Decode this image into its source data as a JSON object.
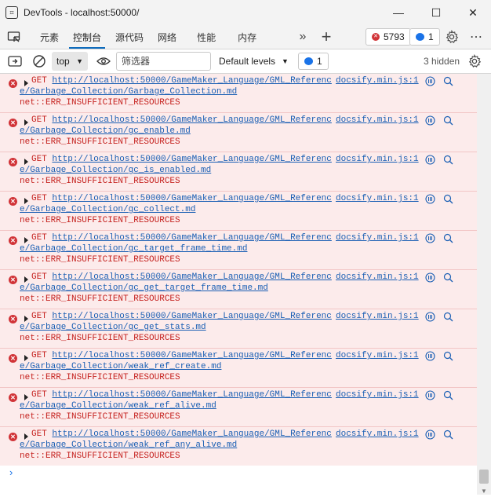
{
  "window": {
    "title": "DevTools - localhost:50000/",
    "app_icon": "devtools-icon",
    "minimize_glyph": "—",
    "maximize_glyph": "☐",
    "close_glyph": "✕"
  },
  "tabs": [
    {
      "label": "元素",
      "active": false
    },
    {
      "label": "控制台",
      "active": true
    },
    {
      "label": "源代码",
      "active": false
    },
    {
      "label": "网络",
      "active": false
    },
    {
      "label": "性能",
      "active": false
    },
    {
      "label": "内存",
      "active": false
    }
  ],
  "tabbar": {
    "more_tabs_glyph": "»",
    "add_tab_glyph": "+",
    "errors_count": "5793",
    "messages_count": "1",
    "more_glyph": "⋯"
  },
  "toolbar": {
    "context": "top",
    "filter_placeholder": "筛选器",
    "levels": "Default levels",
    "issues_count": "1",
    "hidden": "3 hidden"
  },
  "entries": [
    {
      "method": "GET",
      "url_line1": "http://localhost:50000/GameMaker_Language/GML_Referenc",
      "url_line2": "e/Garbage_Collection/Garbage_Collection.md",
      "error": "net::ERR_INSUFFICIENT_RESOURCES",
      "source": "docsify.min.js:1"
    },
    {
      "method": "GET",
      "url_line1": "http://localhost:50000/GameMaker_Language/GML_Referenc",
      "url_line2": "e/Garbage_Collection/gc_enable.md",
      "error": "net::ERR_INSUFFICIENT_RESOURCES",
      "source": "docsify.min.js:1"
    },
    {
      "method": "GET",
      "url_line1": "http://localhost:50000/GameMaker_Language/GML_Referenc",
      "url_line2": "e/Garbage_Collection/gc_is_enabled.md",
      "error": "net::ERR_INSUFFICIENT_RESOURCES",
      "source": "docsify.min.js:1"
    },
    {
      "method": "GET",
      "url_line1": "http://localhost:50000/GameMaker_Language/GML_Referenc",
      "url_line2": "e/Garbage_Collection/gc_collect.md",
      "error": "net::ERR_INSUFFICIENT_RESOURCES",
      "source": "docsify.min.js:1"
    },
    {
      "method": "GET",
      "url_line1": "http://localhost:50000/GameMaker_Language/GML_Referenc",
      "url_line2": "e/Garbage_Collection/gc_target_frame_time.md",
      "error": "net::ERR_INSUFFICIENT_RESOURCES",
      "source": "docsify.min.js:1"
    },
    {
      "method": "GET",
      "url_line1": "http://localhost:50000/GameMaker_Language/GML_Referenc",
      "url_line2": "e/Garbage_Collection/gc_get_target_frame_time.md",
      "error": "net::ERR_INSUFFICIENT_RESOURCES",
      "source": "docsify.min.js:1"
    },
    {
      "method": "GET",
      "url_line1": "http://localhost:50000/GameMaker_Language/GML_Referenc",
      "url_line2": "e/Garbage_Collection/gc_get_stats.md",
      "error": "net::ERR_INSUFFICIENT_RESOURCES",
      "source": "docsify.min.js:1"
    },
    {
      "method": "GET",
      "url_line1": "http://localhost:50000/GameMaker_Language/GML_Referenc",
      "url_line2": "e/Garbage_Collection/weak_ref_create.md",
      "error": "net::ERR_INSUFFICIENT_RESOURCES",
      "source": "docsify.min.js:1"
    },
    {
      "method": "GET",
      "url_line1": "http://localhost:50000/GameMaker_Language/GML_Referenc",
      "url_line2": "e/Garbage_Collection/weak_ref_alive.md",
      "error": "net::ERR_INSUFFICIENT_RESOURCES",
      "source": "docsify.min.js:1"
    },
    {
      "method": "GET",
      "url_line1": "http://localhost:50000/GameMaker_Language/GML_Referenc",
      "url_line2": "e/Garbage_Collection/weak_ref_any_alive.md",
      "error": "net::ERR_INSUFFICIENT_RESOURCES",
      "source": "docsify.min.js:1"
    }
  ],
  "console": {
    "prompt_glyph": "›"
  },
  "colors": {
    "accent": "#0f6cbd",
    "error": "#d13438",
    "error_bg": "#fcebeb",
    "link": "#1a5fb4"
  }
}
